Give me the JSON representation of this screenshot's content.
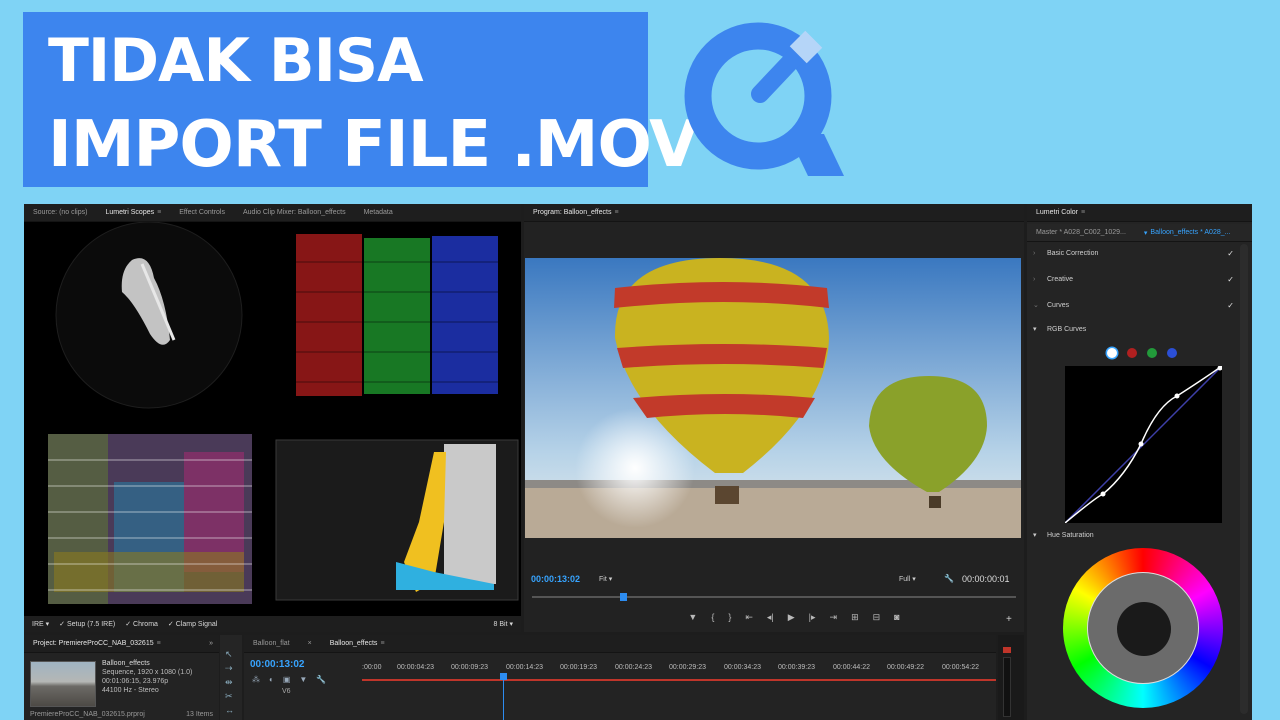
{
  "banner": {
    "line1": "TIDAK BISA",
    "line2": "IMPORT FILE .MOV",
    "bg": "#3d85ee"
  },
  "logo": {
    "icon": "quicktime-icon",
    "color": "#3d85ee"
  },
  "scopes_panel": {
    "tabs": [
      "Source: (no clips)",
      "Lumetri Scopes",
      "Effect Controls",
      "Audio Clip Mixer: Balloon_effects",
      "Metadata"
    ],
    "active_tab": "Lumetri Scopes",
    "footer": {
      "scale": "IRE",
      "setup": "Setup (7.5 IRE)",
      "chroma": "Chroma",
      "clamp": "Clamp Signal",
      "bits": "8 Bit"
    }
  },
  "program": {
    "title": "Program: Balloon_effects",
    "timecode_left": "00:00:13:02",
    "fit": "Fit",
    "quality": "Full",
    "timecode_right": "00:00:00:01"
  },
  "lumetri": {
    "title": "Lumetri Color",
    "source_tabs": [
      "Master * A028_C002_1029...",
      "Balloon_effects * A028_..."
    ],
    "sections": [
      {
        "label": "Basic Correction",
        "checked": true
      },
      {
        "label": "Creative",
        "checked": true
      },
      {
        "label": "Curves",
        "checked": true
      }
    ],
    "rgb_curves": "RGB Curves",
    "hue_saturation": "Hue Saturation",
    "curve_channels": [
      "#ffffff",
      "#c0392b",
      "#27ae60",
      "#2f5fd0"
    ]
  },
  "project": {
    "title": "Project: PremiereProCC_NAB_032615",
    "clip_name": "Balloon_effects",
    "clip_info": [
      "Sequence, 1920 x 1080 (1.0)",
      "00:01:06:15, 23.976p",
      "44100 Hz - Stereo"
    ],
    "file": "PremiereProCC_NAB_032615.prproj",
    "items": "13 Items"
  },
  "timeline": {
    "tabs": [
      "Balloon_flat",
      "Balloon_effects"
    ],
    "active_tab": "Balloon_effects",
    "timecode": "00:00:13:02",
    "track": "V6",
    "ruler": [
      ":00:00",
      "00:00:04:23",
      "00:00:09:23",
      "00:00:14:23",
      "00:00:19:23",
      "00:00:24:23",
      "00:00:29:23",
      "00:00:34:23",
      "00:00:39:23",
      "00:00:44:22",
      "00:00:49:22",
      "00:00:54:22"
    ]
  }
}
